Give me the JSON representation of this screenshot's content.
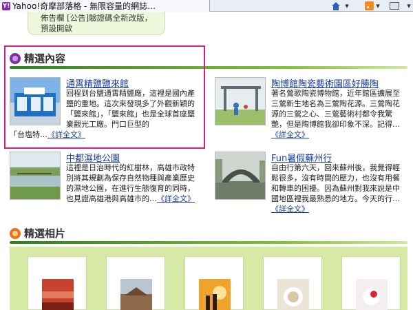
{
  "browser": {
    "tab_title": "Yahoo!奇摩部落格 - 無限容量的網誌…",
    "favicon": "Y!",
    "chevron": "▾"
  },
  "notice": {
    "text": "佈告欄 [公告]驗證碼全新改版，預設開啟"
  },
  "featured": {
    "title": "精選內容",
    "icon": "purple-dot-icon",
    "articles": [
      {
        "title": "通霄精鹽鹽來館",
        "text": "回程到台鹽通霄精鹽廠，這裡是國內產鹽的重地。這次來發現多了外觀新穎的「鹽來館」，「鹽來館」也是全球首座鹽業觀光工廠。門口巨型的「台塩特…",
        "more": "《詳全文》"
      },
      {
        "title": "陶博館陶瓷藝術園區好勝陶",
        "text": "著名鶯歌陶瓷博物館，近年館區擴展至三鶯新生地名為三鶯陶花源。三鶯陶花源的三鶯之心、三鶯藝術村都令我驚艷，但是陶博館我卻印象不深。記得…",
        "more": "《詳全文》"
      },
      {
        "title": "中都濕地公園",
        "text": "這裡是日治時代的紅樹林，高雄市政特別將其規劃為保存自然物種與產業歷史的濕地公園，在進行生態復育的同時，也見證高雄港與高雄市的…",
        "more": "《詳全文》"
      },
      {
        "title": "Fun暑假蘇州行",
        "text": "自由行第六天，回來蘇州後，我覺得輕鬆很多，沒有時間的壓力，也沒有用餐和轉車的困擾。因為蘇州對我來說是中國地區裡我最熟悉的地方。今天的行…",
        "more": "《詳全文》"
      }
    ]
  },
  "photos": {
    "title": "精選相片",
    "icon": "orange-dot-icon",
    "count": 5
  },
  "colors": {
    "highlight": "#d4208a",
    "link": "#1a3d99",
    "divider": "#5aa02c",
    "photo_bg": "#d6eaa6"
  }
}
